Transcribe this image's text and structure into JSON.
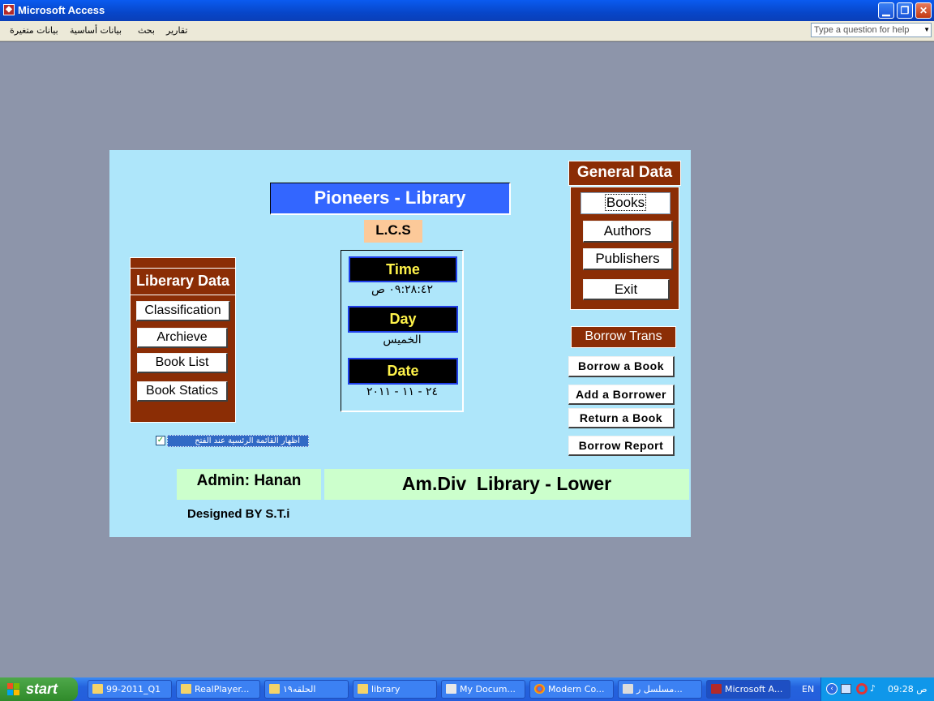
{
  "window": {
    "title": "Microsoft Access"
  },
  "menu": {
    "items": [
      "تقارير",
      "بحث",
      "بيانات أساسية",
      "بيانات متغيرة"
    ],
    "help_placeholder": "Type a question for help"
  },
  "form": {
    "title": "Pioneers - Library",
    "subtitle": "L.C.S",
    "general_data": {
      "header": "General Data",
      "buttons": [
        "Books",
        "Authors",
        "Publishers",
        "Exit"
      ]
    },
    "library_data": {
      "header": "Liberary Data",
      "buttons": [
        "Classification",
        "Archieve",
        "Book List",
        "Book Statics"
      ]
    },
    "clock": {
      "time_label": "Time",
      "time_value": "٠٩:٢٨:٤٢ ص",
      "day_label": "Day",
      "day_value": "الخميس",
      "date_label": "Date",
      "date_value": "٢٤ - ١١ - ٢٠١١"
    },
    "borrow": {
      "header": "Borrow Trans",
      "buttons": [
        "Borrow a Book",
        "Add a Borrower",
        "Return a Book",
        "Borrow Report"
      ]
    },
    "show_menu_checkbox": {
      "label": "اظهار القائمة الرئسية عند الفتح",
      "checked": true
    },
    "admin": "Admin: Hanan",
    "division": "Am.Div  Library - Lower",
    "designer": "Designed BY S.T.i"
  },
  "taskbar": {
    "start_label": "start",
    "tasks": [
      "99-2011_Q1",
      "RealPlayer...",
      "الحلقه١٩",
      "library",
      "My Docum...",
      "Modern Co...",
      "مسلسل ر...",
      "Microsoft A..."
    ],
    "language": "EN",
    "clock": "09:28 ص"
  },
  "colors": {
    "form_bg": "#aee6fa",
    "panel_brown": "#8b2d05",
    "title_blue": "#3366ff",
    "lcs_orange": "#fcc999",
    "admin_green": "#ccffcc",
    "clock_yellow": "#fff34a"
  }
}
